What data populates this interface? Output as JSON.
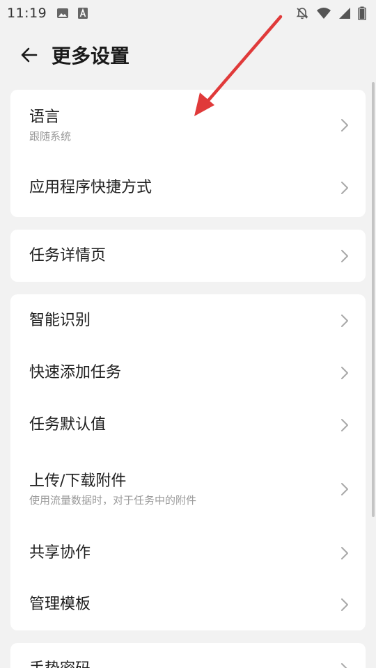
{
  "status_bar": {
    "time": "11:19",
    "left_icons": [
      "image-icon",
      "text-a-icon"
    ],
    "right_icons": [
      "notifications-off-icon",
      "wifi-icon",
      "cell-signal-icon",
      "battery-icon"
    ]
  },
  "header": {
    "back_icon": "arrow-back-icon",
    "title": "更多设置"
  },
  "groups": [
    {
      "items": [
        {
          "title": "语言",
          "subtitle": "跟随系统"
        },
        {
          "title": "应用程序快捷方式"
        }
      ]
    },
    {
      "items": [
        {
          "title": "任务详情页"
        }
      ]
    },
    {
      "items": [
        {
          "title": "智能识别"
        },
        {
          "title": "快速添加任务"
        },
        {
          "title": "任务默认值"
        },
        {
          "title": "上传/下载附件",
          "subtitle": "使用流量数据时，对于任务中的附件"
        },
        {
          "title": "共享协作"
        },
        {
          "title": "管理模板"
        }
      ]
    },
    {
      "items": [
        {
          "title": "手势密码"
        }
      ]
    }
  ],
  "colors": {
    "background": "#f2f2f2",
    "card": "#ffffff",
    "annotation_arrow": "#e03a3a"
  }
}
